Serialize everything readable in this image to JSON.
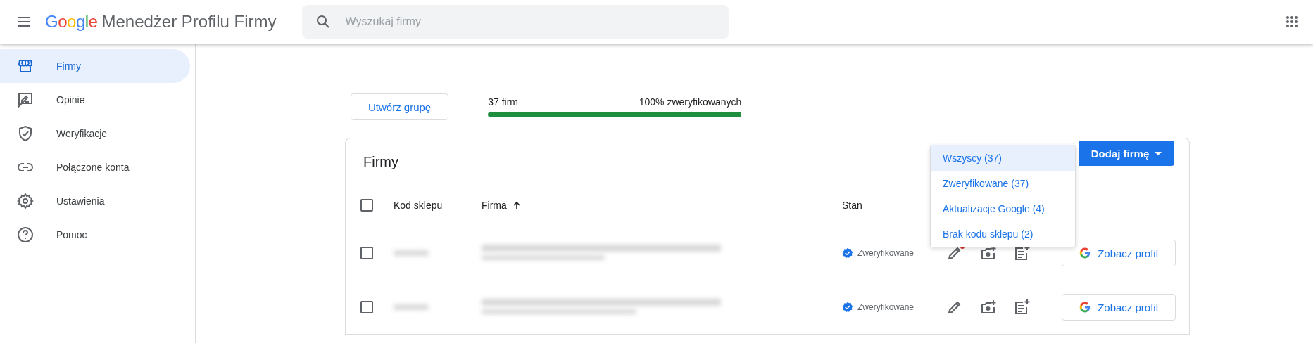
{
  "header": {
    "logo": "Google",
    "title": "Menedżer Profilu Firmy",
    "search": {
      "placeholder": "Wyszukaj firmy"
    }
  },
  "sidebar": {
    "items": [
      {
        "label": "Firmy",
        "kind": "store",
        "selected": true
      },
      {
        "label": "Opinie",
        "kind": "review",
        "selected": false
      },
      {
        "label": "Weryfikacje",
        "kind": "shield",
        "selected": false
      },
      {
        "label": "Połączone konta",
        "kind": "link",
        "selected": false
      },
      {
        "label": "Ustawienia",
        "kind": "gear",
        "selected": false
      },
      {
        "label": "Pomoc",
        "kind": "help",
        "selected": false
      }
    ]
  },
  "toolbar": {
    "create_group": "Utwórz grupę",
    "summary": {
      "count": "37 firm",
      "verified": "100% zweryfikowanych",
      "level": 1
    }
  },
  "card": {
    "title": "Firmy",
    "add_button": "Dodaj firmę",
    "filter_menu": [
      {
        "label": "Wszyscy (37)",
        "selected": true
      },
      {
        "label": "Zweryfikowane (37)",
        "selected": false
      },
      {
        "label": "Aktualizacje Google (4)",
        "selected": false
      },
      {
        "label": "Brak kodu sklepu (2)",
        "selected": false
      }
    ],
    "table": {
      "select_all": {
        "checked": false
      },
      "columns": [
        "Kod sklepu",
        "Firma",
        "Stan"
      ],
      "sort_ascending": true,
      "rows": [
        {
          "checked": false,
          "status": "Zweryfikowane",
          "edit_notification": true,
          "view_button": "Zobacz profil"
        },
        {
          "checked": false,
          "status": "Zweryfikowane",
          "edit_notification": false,
          "view_button": "Zobacz profil"
        }
      ]
    }
  }
}
